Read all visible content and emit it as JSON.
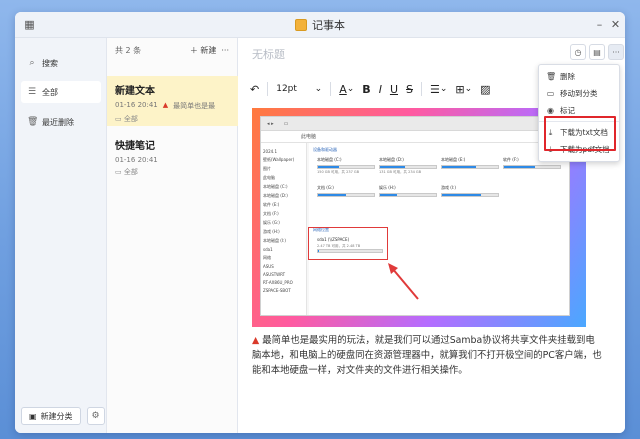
{
  "window": {
    "title": "记事本"
  },
  "sidebar": {
    "search_label": "搜索",
    "items": [
      {
        "label": "全部"
      },
      {
        "label": "最近删除"
      }
    ],
    "new_category_label": "新建分类"
  },
  "notelist": {
    "count_label": "共 2 条",
    "new_label": "新建",
    "notes": [
      {
        "title": "新建文本",
        "date": "01-16 20:41",
        "preview": "最简单也是最",
        "category": "全部"
      },
      {
        "title": "快捷笔记",
        "date": "01-16 20:41",
        "preview": "",
        "category": "全部"
      }
    ]
  },
  "editor": {
    "title_placeholder": "无标题",
    "font_size": "12pt",
    "caption": "最简单也是最实用的玩法，就是我们可以通过Samba协议将共享文件夹挂载到电脑本地，和电脑上的硬盘同在资源管理器中，就算我们不打开极空间的PC客户端，也能和本地硬盘一样，对文件夹的文件进行相关操作。"
  },
  "menu": {
    "items": [
      {
        "label": "删除",
        "icon": "trash-icon"
      },
      {
        "label": "移动到分类",
        "icon": "folder-move-icon"
      },
      {
        "label": "标记",
        "icon": "mark-icon"
      },
      {
        "label": "下载为txt文档",
        "icon": "download-icon"
      },
      {
        "label": "下载为pdf文档",
        "icon": "download-icon"
      }
    ]
  },
  "screenshot_content": {
    "address": "此电脑",
    "section_devices": "设备和驱动器",
    "section_network": "网络位置",
    "drives": [
      {
        "name": "本地磁盘 (C:)",
        "size": "150 GB 可用，共 237 GB",
        "used": 0.37
      },
      {
        "name": "本地磁盘 (D:)",
        "size": "131 GB 可用，共 234 GB",
        "used": 0.44
      },
      {
        "name": "本地磁盘 (E:)",
        "size": "",
        "used": 0.6
      },
      {
        "name": "软件 (F:)",
        "size": "",
        "used": 0.55
      },
      {
        "name": "文档 (G:)",
        "size": "",
        "used": 0.5
      },
      {
        "name": "娱乐 (H:)",
        "size": "",
        "used": 0.3
      },
      {
        "name": "游戏 (I:)",
        "size": "",
        "used": 0.7
      }
    ],
    "network_drive": {
      "name": "sda1 (\\\\ZSPACE)",
      "size": "2.47 TB 可用，共 2.48 TB",
      "used": 0.02
    },
    "sidebar_items": [
      "2024.1",
      "壁纸(Wallpaper)",
      "图片",
      "此电脑",
      "本地磁盘 (C:)",
      "本地磁盘 (D:)",
      "软件 (E:)",
      "文档 (F:)",
      "娱乐 (G:)",
      "游戏 (H:)",
      "本地磁盘 (I:)",
      "sda1",
      "网络",
      "ASUS",
      "ASUSTWRT",
      "RT-AX86U_PRO",
      "ZSPACE-SBOT"
    ]
  }
}
